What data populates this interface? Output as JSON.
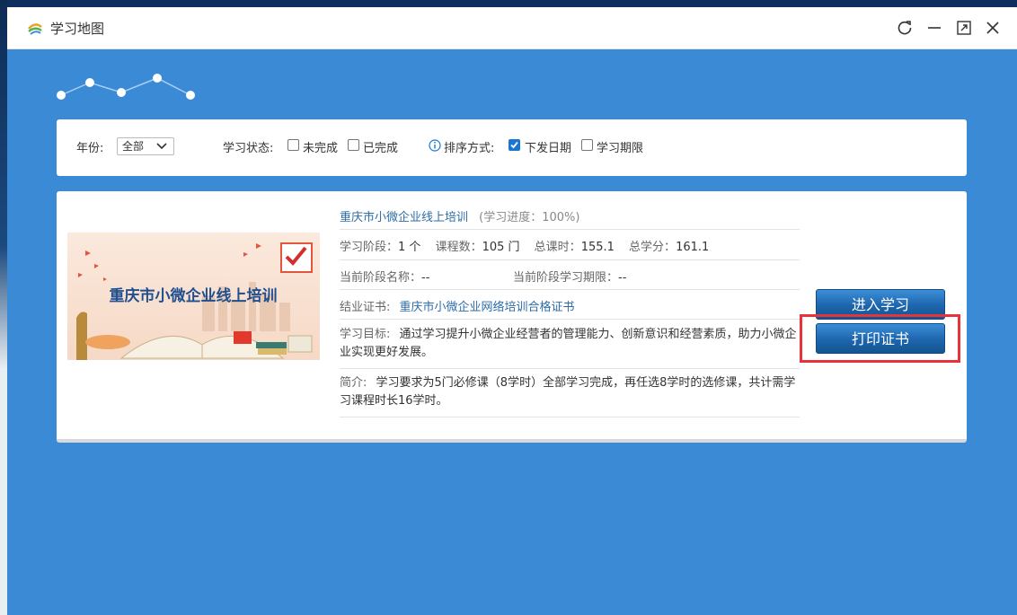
{
  "window": {
    "title": "学习地图",
    "controls": [
      "refresh-icon",
      "minimize-icon",
      "maximize-icon",
      "close-icon"
    ]
  },
  "filters": {
    "year_label": "年份:",
    "year_value": "全部",
    "status_label": "学习状态:",
    "status_options": [
      {
        "label": "未完成",
        "checked": false
      },
      {
        "label": "已完成",
        "checked": false
      }
    ],
    "sort_label": "排序方式:",
    "sort_options": [
      {
        "label": "下发日期",
        "checked": true
      },
      {
        "label": "学习期限",
        "checked": false
      }
    ]
  },
  "course": {
    "banner_text": "重庆市小微企业线上培训",
    "title": "重庆市小微企业线上培训",
    "progress": "(学习进度：100%)",
    "stage_label": "学习阶段：",
    "stage_value": "1 个",
    "course_count_label": "课程数：",
    "course_count_value": "105 门",
    "total_hours_label": "总课时：",
    "total_hours_value": "155.1",
    "total_credits_label": "总学分：",
    "total_credits_value": "161.1",
    "current_stage_name_label": "当前阶段名称：",
    "current_stage_name_value": "--",
    "current_stage_period_label": "当前阶段学习期限：",
    "current_stage_period_value": "--",
    "certificate_label": "结业证书:",
    "certificate_value": "重庆市小微企业网络培训合格证书",
    "goal_label": "学习目标:",
    "goal_value": "通过学习提升小微企业经营者的管理能力、创新意识和经营素质，助力小微企业实现更好发展。",
    "intro_label": "简介:",
    "intro_value": "学习要求为5门必修课（8学时）全部学习完成，再任选8学时的选修课，共计需学习课程时长16学时。"
  },
  "actions": {
    "enter_label": "进入学习",
    "print_label": "打印证书"
  },
  "colors": {
    "accent": "#3a8ad6",
    "link": "#2d6da8",
    "highlight": "#e8333a",
    "button": "#1d65ad"
  }
}
